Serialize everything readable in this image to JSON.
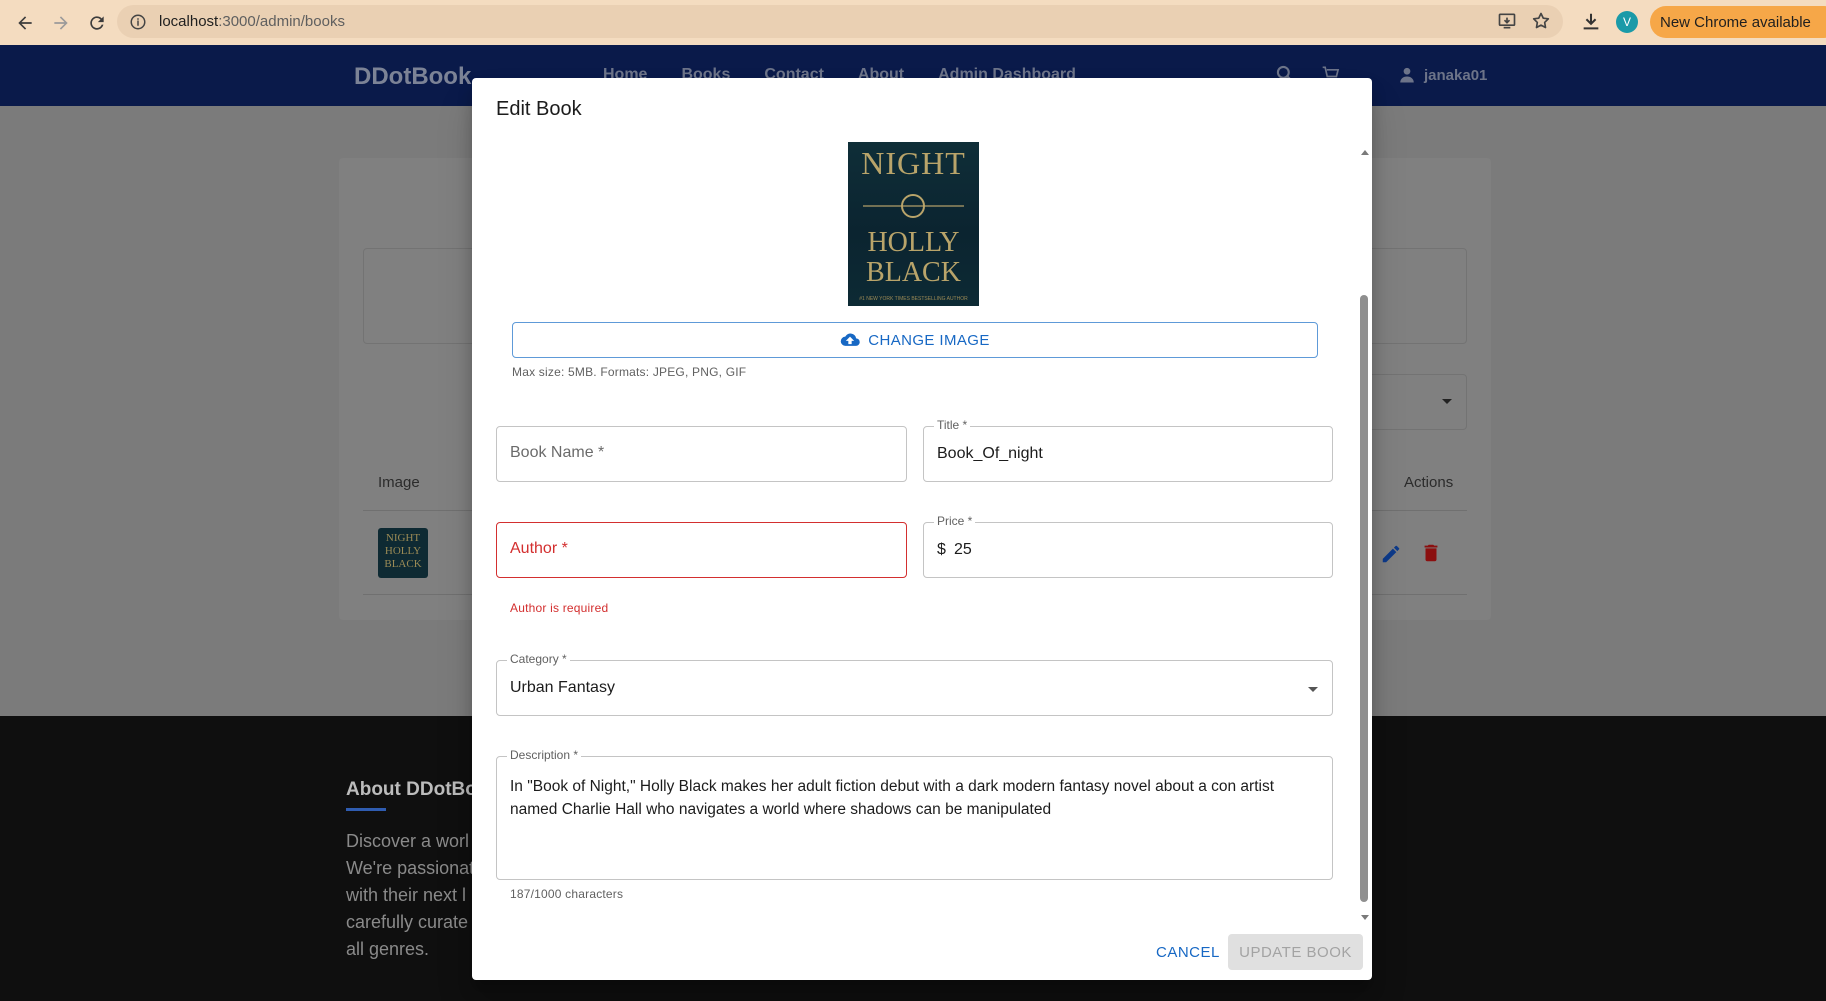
{
  "browser": {
    "url_host": "localhost",
    "url_path": ":3000/admin/books",
    "chrome_update": "New Chrome available",
    "profile_initial": "V"
  },
  "app": {
    "brand": "DDotBook",
    "nav": [
      "Home",
      "Books",
      "Contact",
      "About",
      "Admin Dashboard"
    ],
    "username": "janaka01",
    "table": {
      "col_image": "Image",
      "col_actions": "Actions"
    },
    "thumb_text": "NIGHT HOLLY BLACK",
    "footer": {
      "about_title": "About DDotBo",
      "about_text": "Discover a worl We're passionat with their next l carefully curate all genres."
    }
  },
  "modal": {
    "title": "Edit Book",
    "cover": {
      "title_word": "NIGHT",
      "author_lines": "HOLLY BLACK",
      "tagline": "#1 NEW YORK TIMES BESTSELLING AUTHOR"
    },
    "change_image_label": "CHANGE IMAGE",
    "image_hint": "Max size: 5MB. Formats: JPEG, PNG, GIF",
    "book_name": {
      "label": "Book Name *",
      "value": ""
    },
    "title_field": {
      "label": "Title *",
      "value": "Book_Of_night"
    },
    "author": {
      "label": "Author *",
      "value": "",
      "error": "Author is required"
    },
    "price": {
      "label": "Price *",
      "prefix": "$",
      "value": "25"
    },
    "category": {
      "label": "Category *",
      "value": "Urban Fantasy"
    },
    "description": {
      "label": "Description *",
      "value": "In \"Book of Night,\" Holly Black makes her adult fiction debut with a dark modern fantasy novel about a con artist named Charlie Hall who navigates a world where shadows can be manipulated",
      "counter": "187/1000 characters"
    },
    "cancel_label": "CANCEL",
    "update_label": "UPDATE BOOK"
  },
  "colors": {
    "primary": "#1768c4",
    "error": "#d32f2f",
    "header": "#0a1a4a",
    "chrome_bar": "#f4dcc0",
    "update_pill": "#f6a748"
  }
}
